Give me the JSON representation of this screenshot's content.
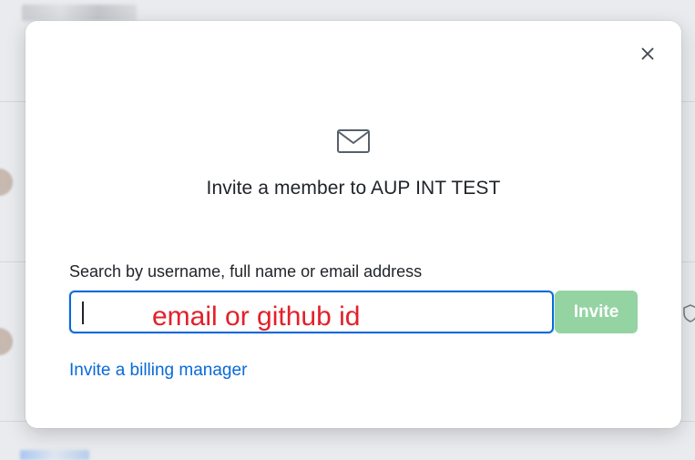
{
  "modal": {
    "title": "Invite a member to AUP INT TEST",
    "search": {
      "label": "Search by username, full name or email address",
      "value": "",
      "placeholder": ""
    },
    "invite_button": "Invite",
    "billing_link": "Invite a billing manager",
    "annotation": "email or github id"
  },
  "icons": {
    "close": "close-icon",
    "mail": "mail-icon",
    "shield": "shield-icon"
  },
  "colors": {
    "primary_blue": "#0969da",
    "invite_disabled_green": "#94d3a2",
    "annotation_red": "#e3202a",
    "overlay_bg": "#e9ebee"
  }
}
